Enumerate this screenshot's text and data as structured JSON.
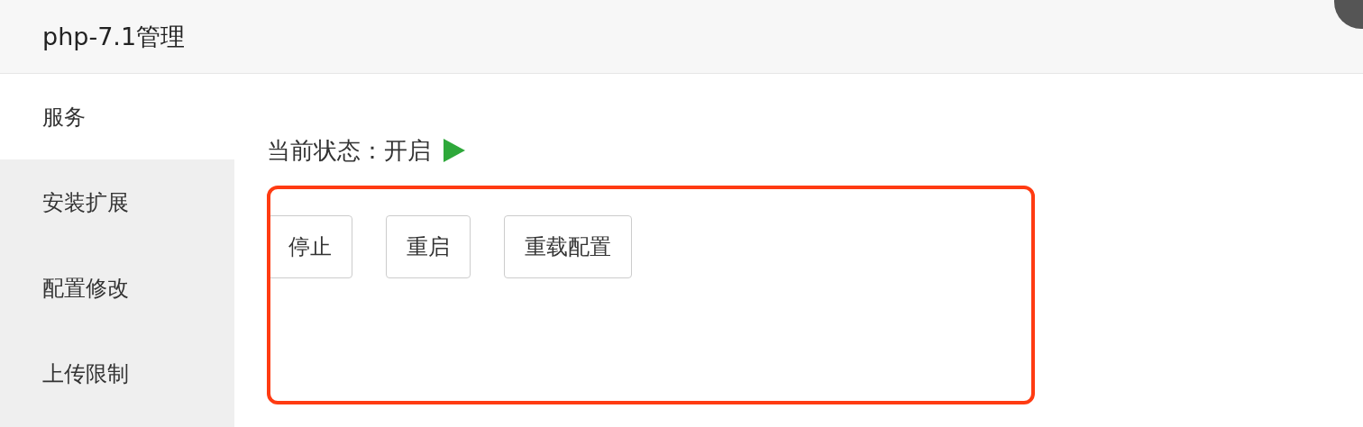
{
  "window": {
    "title": "php-7.1管理"
  },
  "sidebar": {
    "items": [
      {
        "label": "服务",
        "selected": true
      },
      {
        "label": "安装扩展",
        "selected": false
      },
      {
        "label": "配置修改",
        "selected": false
      },
      {
        "label": "上传限制",
        "selected": false
      }
    ]
  },
  "status": {
    "label": "当前状态：",
    "value": "开启",
    "running": true
  },
  "actions": {
    "highlighted": true,
    "buttons": [
      "停止",
      "重启",
      "重载配置"
    ]
  }
}
